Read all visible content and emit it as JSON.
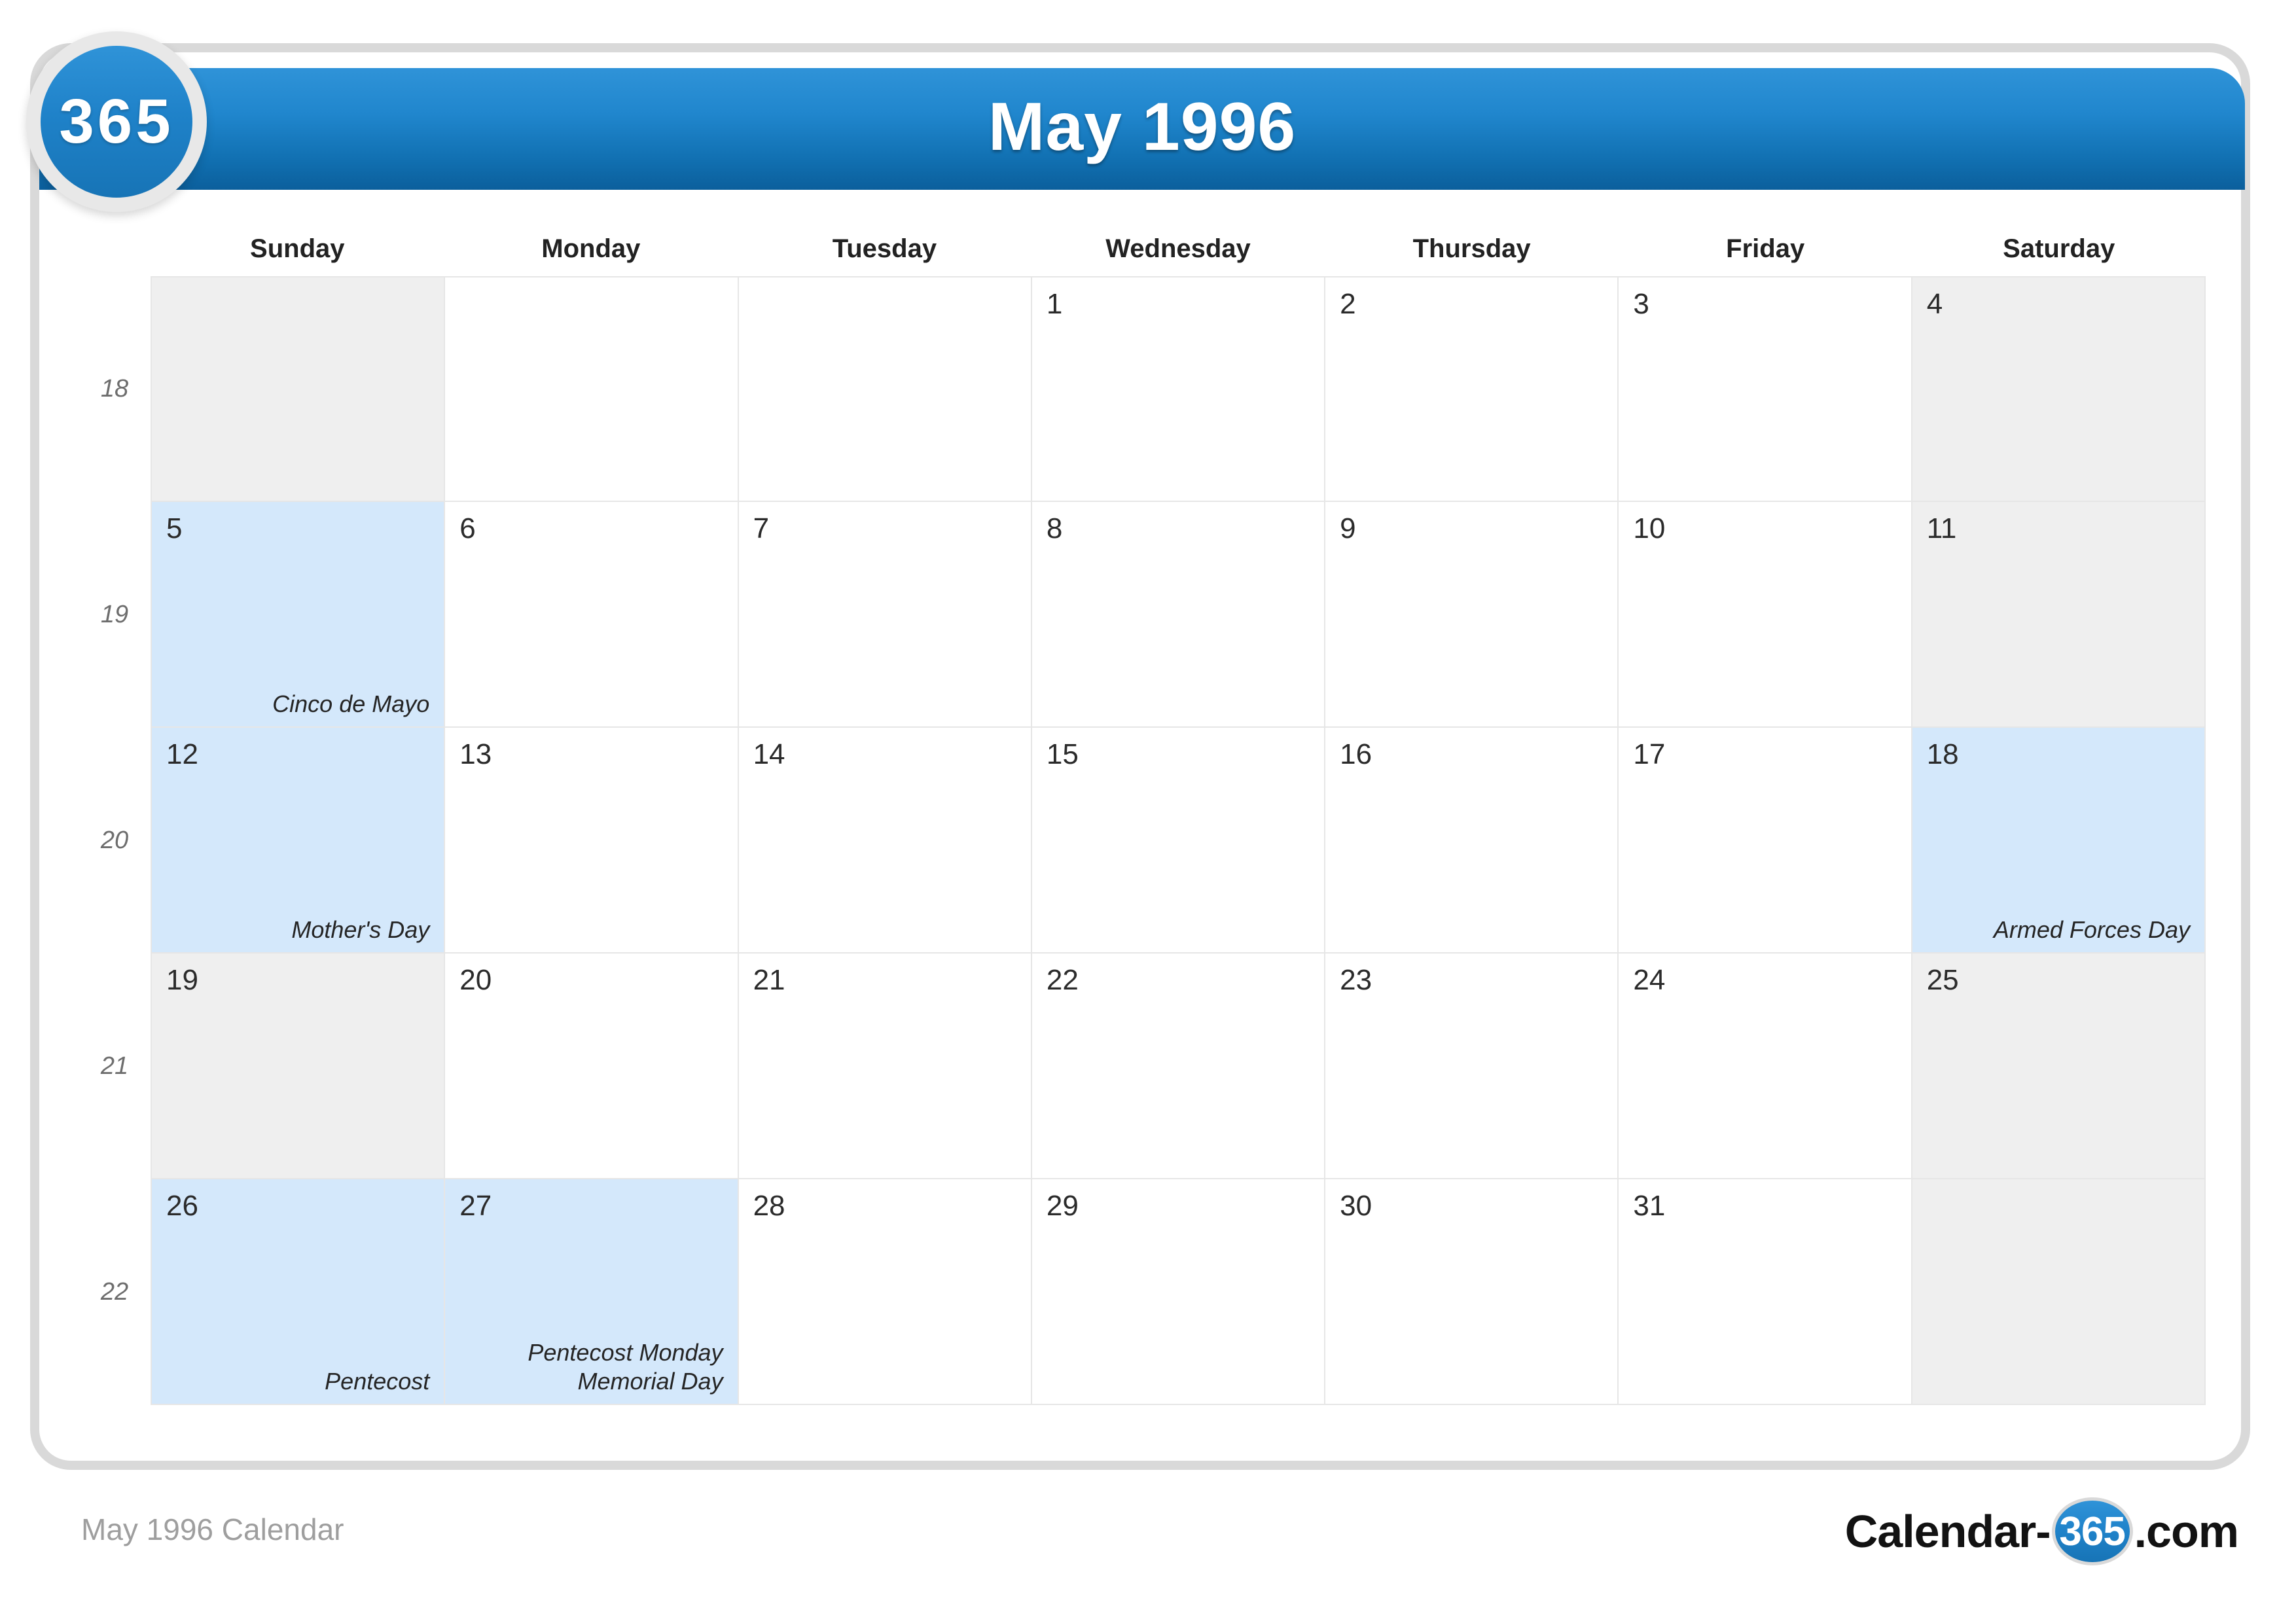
{
  "badge": {
    "label": "365"
  },
  "header": {
    "title": "May 1996"
  },
  "watermark": {
    "text": "365"
  },
  "weekday_headers": [
    "Sunday",
    "Monday",
    "Tuesday",
    "Wednesday",
    "Thursday",
    "Friday",
    "Saturday"
  ],
  "week_numbers": [
    "18",
    "19",
    "20",
    "21",
    "22"
  ],
  "weeks": [
    {
      "week": "18",
      "days": [
        {
          "num": "",
          "events": [],
          "style": "blank"
        },
        {
          "num": "",
          "events": [],
          "style": "blank-white"
        },
        {
          "num": "",
          "events": [],
          "style": "blank-white"
        },
        {
          "num": "1",
          "events": [],
          "style": "normal"
        },
        {
          "num": "2",
          "events": [],
          "style": "normal"
        },
        {
          "num": "3",
          "events": [],
          "style": "normal"
        },
        {
          "num": "4",
          "events": [],
          "style": "weekend"
        }
      ]
    },
    {
      "week": "19",
      "days": [
        {
          "num": "5",
          "events": [
            "Cinco de Mayo"
          ],
          "style": "holiday"
        },
        {
          "num": "6",
          "events": [],
          "style": "normal"
        },
        {
          "num": "7",
          "events": [],
          "style": "normal"
        },
        {
          "num": "8",
          "events": [],
          "style": "normal"
        },
        {
          "num": "9",
          "events": [],
          "style": "normal"
        },
        {
          "num": "10",
          "events": [],
          "style": "normal"
        },
        {
          "num": "11",
          "events": [],
          "style": "weekend"
        }
      ]
    },
    {
      "week": "20",
      "days": [
        {
          "num": "12",
          "events": [
            "Mother's Day"
          ],
          "style": "holiday"
        },
        {
          "num": "13",
          "events": [],
          "style": "normal"
        },
        {
          "num": "14",
          "events": [],
          "style": "normal"
        },
        {
          "num": "15",
          "events": [],
          "style": "normal"
        },
        {
          "num": "16",
          "events": [],
          "style": "normal"
        },
        {
          "num": "17",
          "events": [],
          "style": "normal"
        },
        {
          "num": "18",
          "events": [
            "Armed Forces Day"
          ],
          "style": "holiday"
        }
      ]
    },
    {
      "week": "21",
      "days": [
        {
          "num": "19",
          "events": [],
          "style": "weekend"
        },
        {
          "num": "20",
          "events": [],
          "style": "normal"
        },
        {
          "num": "21",
          "events": [],
          "style": "normal"
        },
        {
          "num": "22",
          "events": [],
          "style": "normal"
        },
        {
          "num": "23",
          "events": [],
          "style": "normal"
        },
        {
          "num": "24",
          "events": [],
          "style": "normal"
        },
        {
          "num": "25",
          "events": [],
          "style": "weekend"
        }
      ]
    },
    {
      "week": "22",
      "days": [
        {
          "num": "26",
          "events": [
            "Pentecost"
          ],
          "style": "holiday"
        },
        {
          "num": "27",
          "events": [
            "Pentecost Monday",
            "Memorial Day"
          ],
          "style": "holiday"
        },
        {
          "num": "28",
          "events": [],
          "style": "normal"
        },
        {
          "num": "29",
          "events": [],
          "style": "normal"
        },
        {
          "num": "30",
          "events": [],
          "style": "normal"
        },
        {
          "num": "31",
          "events": [],
          "style": "normal"
        },
        {
          "num": "",
          "events": [],
          "style": "blank"
        }
      ]
    }
  ],
  "footer": {
    "left_label": "May 1996 Calendar",
    "logo_prefix": "Calendar-",
    "logo_badge": "365",
    "logo_suffix": ".com"
  },
  "colors": {
    "header_blue_light": "#2f93d8",
    "header_blue_dark": "#0b5f9c",
    "holiday_bg": "#d4e8fb",
    "weekend_bg": "#efefef",
    "frame_border": "#d9d9d9",
    "grid_line": "#e6e6e6",
    "footer_text": "#9e9e9e"
  }
}
